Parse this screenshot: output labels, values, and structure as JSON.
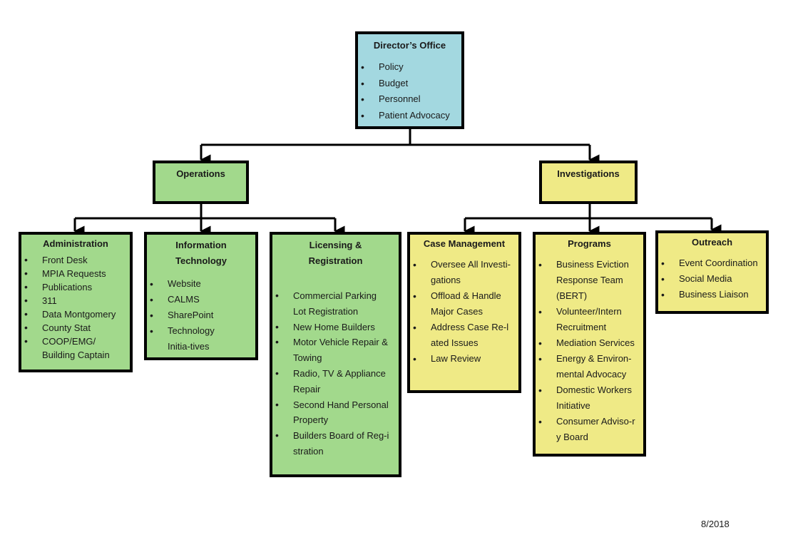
{
  "director": {
    "title": "Director’s Office",
    "items": [
      "Policy",
      "Budget",
      "Personnel",
      "Patient Advocacy"
    ],
    "color": "#a3d8e0"
  },
  "operations": {
    "title": "Operations",
    "color": "#a2d98c"
  },
  "investigations": {
    "title": "Investigations",
    "color": "#efea86"
  },
  "administration": {
    "title": "Administration",
    "items": [
      "Front Desk",
      "MPIA Requests",
      "Publications",
      "311",
      "Data Montgomery",
      "County Stat",
      "COOP/EMG/ Building Captain"
    ]
  },
  "it": {
    "title": "Information Technology",
    "items": [
      "Website",
      "CALMS",
      "SharePoint",
      "Technology Initia-tives"
    ]
  },
  "licensing": {
    "title": "Licensing & Registration",
    "items": [
      "Commercial Parking Lot Registration",
      "New Home Builders",
      "Motor Vehicle Repair & Towing",
      "Radio, TV & Appliance Repair",
      "Second Hand Personal Property",
      "Builders Board of Reg-istration"
    ]
  },
  "case_management": {
    "title": "Case Management",
    "items": [
      "Oversee All Investi-gations",
      "Offload & Handle Major Cases",
      "Address Case Re-lated Issues",
      "Law Review"
    ]
  },
  "programs": {
    "title": "Programs",
    "items": [
      "Business Eviction Response Team (BERT)",
      "Volunteer/Intern Recruitment",
      "Mediation Services",
      "Energy & Environ-mental Advocacy",
      "Domestic Workers Initiative",
      "Consumer Adviso-ry Board"
    ]
  },
  "outreach": {
    "title": "Outreach",
    "items": [
      "Event Coordination",
      "Social Media",
      "Business Liaison"
    ]
  },
  "footer": {
    "date": "8/2018"
  }
}
